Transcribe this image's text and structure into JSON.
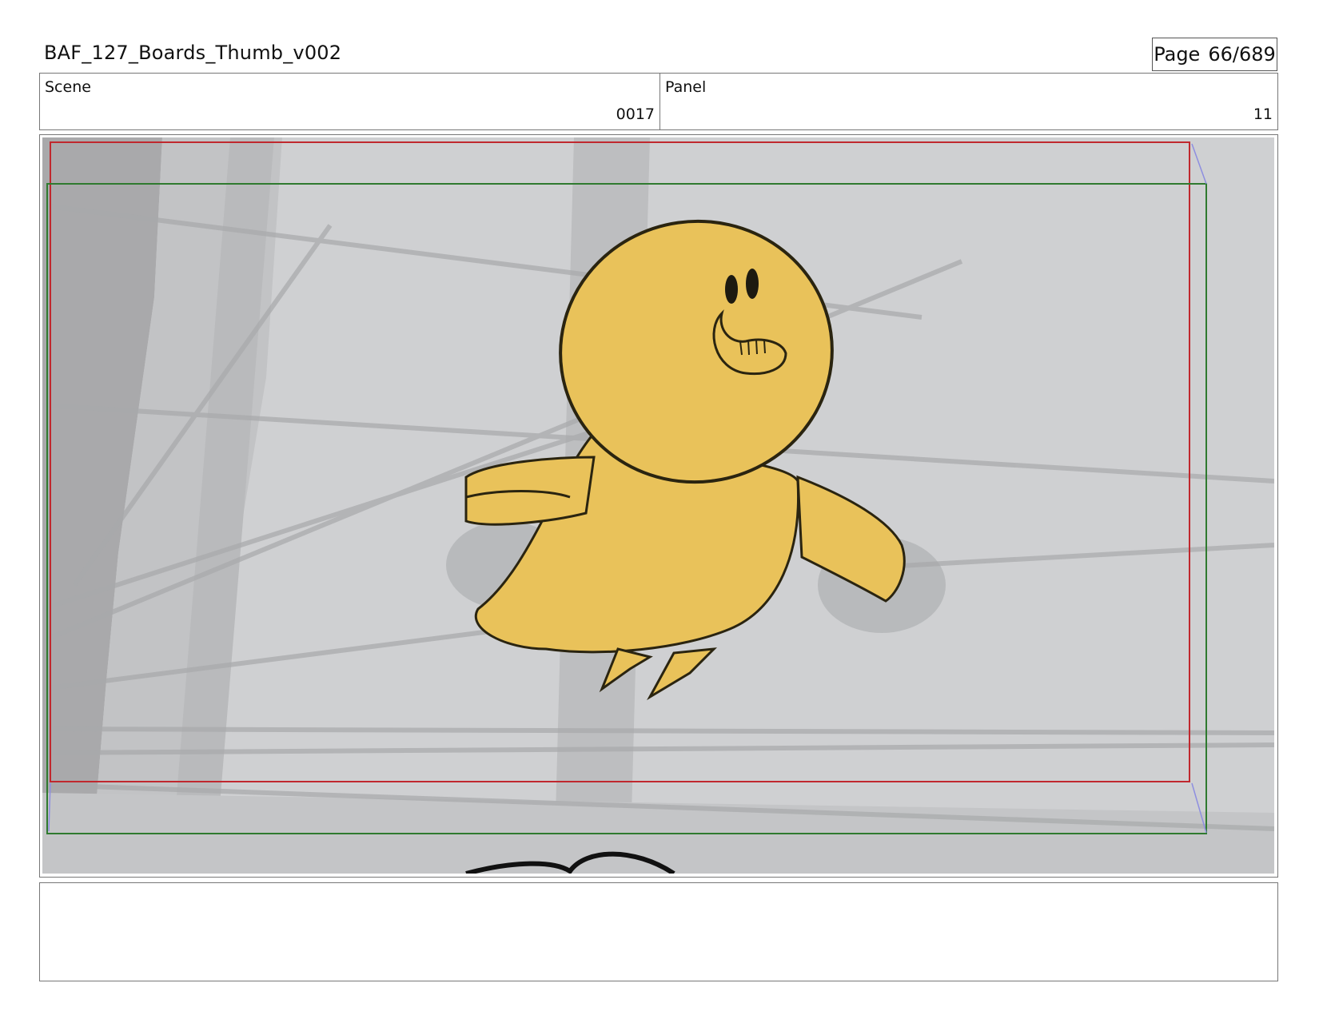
{
  "header": {
    "doc_title": "BAF_127_Boards_Thumb_v002",
    "page_label": "Page",
    "page_number": "66/689"
  },
  "info": {
    "scene_label": "Scene",
    "scene_value": "0017",
    "panel_label": "Panel",
    "panel_value": "11"
  },
  "notes": {
    "text": ""
  },
  "colors": {
    "safe_frame_red": "#c0282e",
    "safe_frame_green": "#2f7a2f",
    "character_fill": "#e9c25a",
    "background_gray": "#cfd0d2"
  }
}
